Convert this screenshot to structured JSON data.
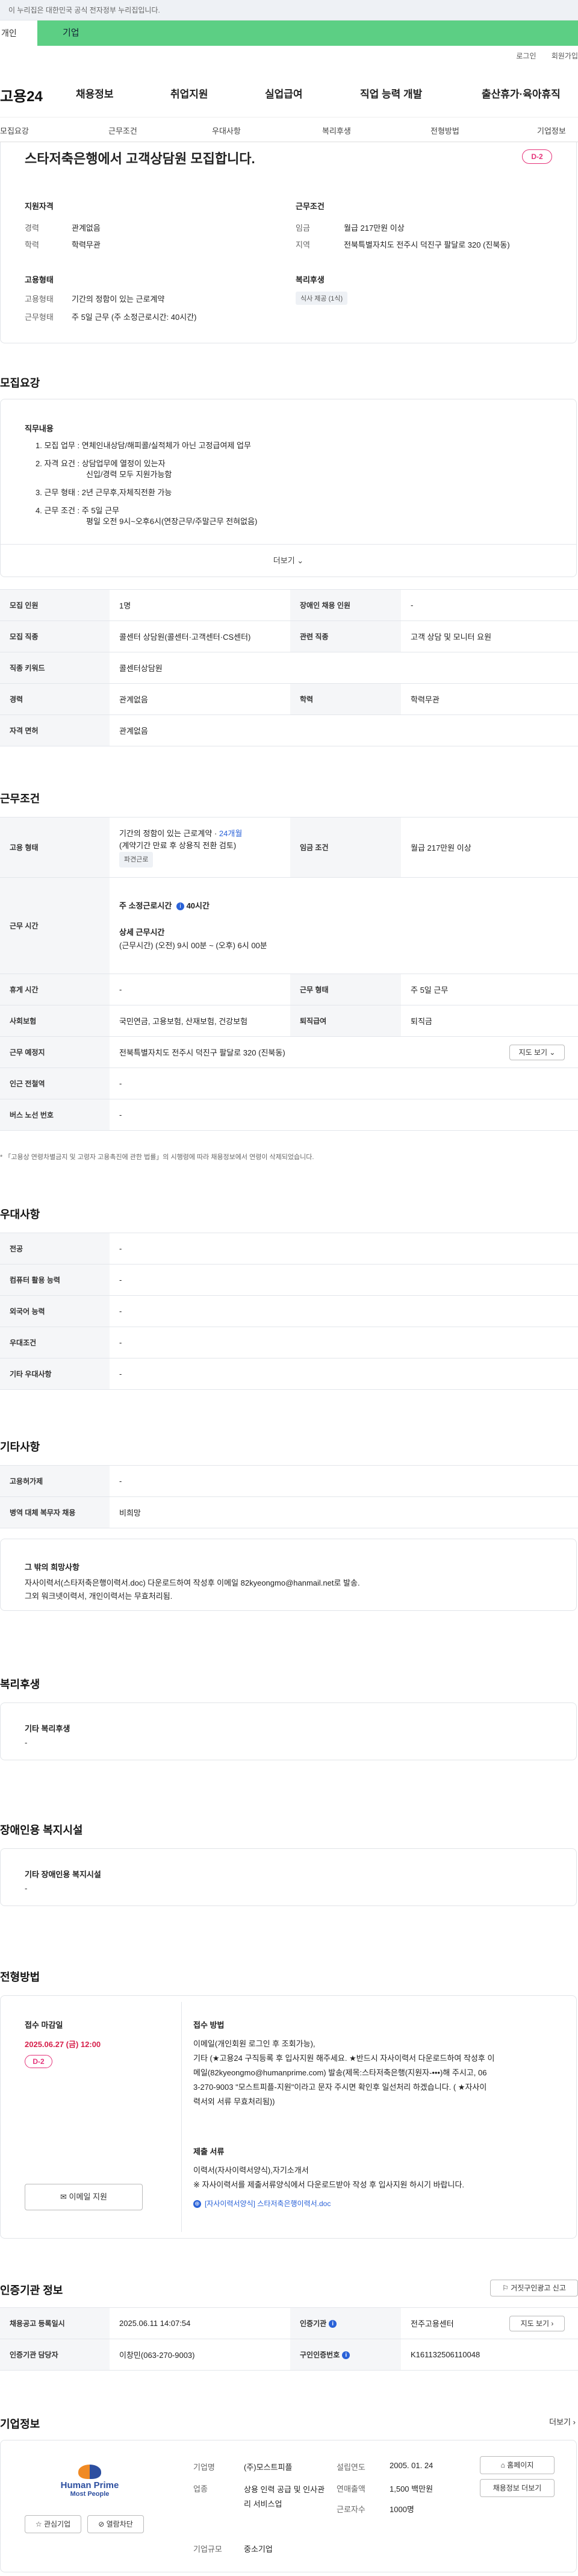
{
  "topbar": {
    "notice": "이 누리집은 대한민국 공식 전자정부 누리집입니다.",
    "tab_personal": "개인",
    "tab_company": "기업"
  },
  "util": {
    "login": "로그인",
    "signup": "회원가입"
  },
  "header": {
    "logo": "고용24",
    "nav": [
      "채용정보",
      "취업지원",
      "실업급여",
      "직업 능력 개발",
      "출산휴가·육아휴직"
    ]
  },
  "subnav": [
    "모집요강",
    "근무조건",
    "우대사항",
    "복리후생",
    "전형방법",
    "기업정보"
  ],
  "summary": {
    "title": "스타저축은행에서 고객상담원 모집합니다.",
    "dday": "D-2",
    "qual_title": "지원자격",
    "career_label": "경력",
    "career": "관계없음",
    "edu_label": "학력",
    "edu": "학력무관",
    "emp_title": "고용형태",
    "emptype_label": "고용형태",
    "emptype": "기간의 정함이 있는 근로계약",
    "worktime_label": "근무형태",
    "worktime": "주 5일 근무 (주 소정근로시간: 40시간)",
    "cond_title": "근무조건",
    "wage_label": "임금",
    "wage": "월급 217만원 이상",
    "region_label": "지역",
    "region": "전북특별자치도 전주시 덕진구 팔달로 320 (진북동)",
    "welfare_title": "복리후생",
    "welfare_chip": "식사 제공 (1식)"
  },
  "recruit": {
    "heading": "모집요강",
    "duty_title": "직무내용",
    "duties": [
      "1. 모집 업무 : 연체인내상담/해피콜/실적체가 아닌 고정급여제 업무",
      "2. 자격 요건 : 상담업무에 열정이 있는자",
      "신입/경력 모두 지원가능함",
      "3. 근무 형태 : 2년 근무후,자체직전환 가능",
      "4. 근무 조건 : 주 5일 근무",
      "평일 오전 9시~오후6시(연장근무/주말근무 전혀없음)"
    ],
    "more": "더보기",
    "rows": [
      {
        "k1": "모집 인원",
        "v1": "1명",
        "k2": "장애인 채용 인원",
        "v2": "-"
      },
      {
        "k1": "모집 직종",
        "v1": "콜센터 상담원(콜센터·고객센터·CS센터)",
        "k2": "관련 직종",
        "v2": "고객 상담 및 모니터 요원"
      },
      {
        "k1": "직종 키워드",
        "v1": "콜센터상담원"
      },
      {
        "k1": "경력",
        "v1": "관계없음",
        "k2": "학력",
        "v2": "학력무관"
      },
      {
        "k1": "자격 면허",
        "v1": "관계없음"
      }
    ]
  },
  "work": {
    "heading": "근무조건",
    "emp_label": "고용 형태",
    "emp_line1": "기간의 정함이 있는 근로계약 · ",
    "emp_months": "24개월",
    "emp_line2": "(계약기간 만료 후 상용직 전환 검토)",
    "emp_chip": "파견근로",
    "wage_label": "임금 조건",
    "wage": "월급 217만원 이상",
    "time_label": "근무 시간",
    "time_week": "주 소정근로시간 ",
    "time_week_info": "i",
    "time_week_val": "40시간",
    "time_detail_title": "상세 근무시간",
    "time_detail": "(근무시간) (오전) 9시 00분 ~ (오후) 6시 00분",
    "rest_label": "휴게 시간",
    "rest": "-",
    "shift_label": "근무 형태",
    "shift": "주 5일 근무",
    "ins_label": "사회보험",
    "ins": "국민연금, 고용보험, 산재보험, 건강보험",
    "ret_label": "퇴직급여",
    "ret": "퇴직금",
    "loc_label": "근무 예정지",
    "loc": "전북특별자치도 전주시 덕진구 팔달로 320 (진북동)",
    "map_btn": "지도 보기",
    "station_label": "인근 전철역",
    "station": "-",
    "bus_label": "버스 노선 번호",
    "bus": "-",
    "note": "* 「고용상 연령차별금지 및 고령자 고용촉진에 관한 법률」의 시행령에 따라 채용정보에서 연령이 삭제되었습니다."
  },
  "pref": {
    "heading": "우대사항",
    "rows": [
      [
        "전공",
        "-"
      ],
      [
        "컴퓨터 활용 능력",
        "-"
      ],
      [
        "외국어 능력",
        "-"
      ],
      [
        "우대조건",
        "-"
      ],
      [
        "기타 우대사항",
        "-"
      ]
    ]
  },
  "etc": {
    "heading": "기타사항",
    "rows": [
      [
        "고용허가제",
        "-"
      ],
      [
        "병역 대체 복무자 채용",
        "비희망"
      ]
    ],
    "box_title": "그 밖의 희망사항",
    "box_line1": "자사이력서(스타저축은행이력서.doc) 다운로드하여 작성후 이메일 82kyeongmo@hanmail.net로 발송.",
    "box_line2": "그외 워크넷이력서, 개인이력서는 무효처리됨."
  },
  "welfare": {
    "heading": "복리후생",
    "box_title": "기타 복리후생",
    "box_val": "-"
  },
  "disabled": {
    "heading": "장애인용 복지시설",
    "box_title": "기타 장애인용 복지시설",
    "box_val": "-"
  },
  "process": {
    "heading": "전형방법",
    "deadline_title": "접수 마감일",
    "deadline": "2025.06.27 (금) 12:00",
    "dday": "D-2",
    "apply_btn": "이메일 지원",
    "method_title": "접수 방법",
    "method_lines": [
      "이메일(개인회원 로그인 후 조회가능),",
      "기타 (★고용24 구직등록 후  입사지원 해주세요.  ★반드시 자사이력서 다운로드하여 작성후 이",
      "메일(82kyeongmo@humanprime.com) 발송(제목:스타저축은행(지원자-•••)해 주시고, 06",
      "3-270-9003 \"모스트피플-지원\"이라고 문자 주시면 확인후 일선처리 하겠습니다.  ( ★자사이",
      "력서외 서류 무효처리됨))"
    ],
    "docs_title": "제출 서류",
    "docs_lines": [
      "이력서(자사이력서양식),자기소개서",
      "※ 자사이력서를 제출서류양식에서 다운로드받아 작성 후 입사지원 하시기 바랍니다."
    ],
    "attach": "[자사이력서양식] 스타저축은행이력서.doc"
  },
  "auth": {
    "heading": "인증기관 정보",
    "report_btn": "거짓구인광고 신고",
    "reg_label": "채용공고 등록일시",
    "reg": "2025.06.11 14:07:54",
    "org_label": "인증기관",
    "org": "전주고용센터",
    "map_btn": "지도 보기",
    "mgr_label": "인증기관 담당자",
    "mgr": "이창민(063-270-9003)",
    "no_label": "구인인증번호",
    "no": "K161132506110048"
  },
  "company": {
    "heading": "기업정보",
    "more": "더보기",
    "logo_text1": "Human Prime",
    "logo_text2": "Most People",
    "fav_btn": "관심기업",
    "block_btn": "열람차단",
    "name_label": "기업명",
    "name": "(주)모스트피플",
    "found_label": "설립연도",
    "found": "2005. 01. 24",
    "biz_label": "업종",
    "biz": "상용 인력 공급 및 인사관리 서비스업",
    "sales_label": "연매출액",
    "sales": "1,500 백만원",
    "staff_label": "근로자수",
    "staff": "1000명",
    "scale_label": "기업규모",
    "scale": "중소기업",
    "home_btn": "홈페이지",
    "more_btn": "채용정보 더보기"
  },
  "colors": {
    "accent": "#5ccf84",
    "dday": "#e5337a",
    "link": "#2a62d8"
  }
}
